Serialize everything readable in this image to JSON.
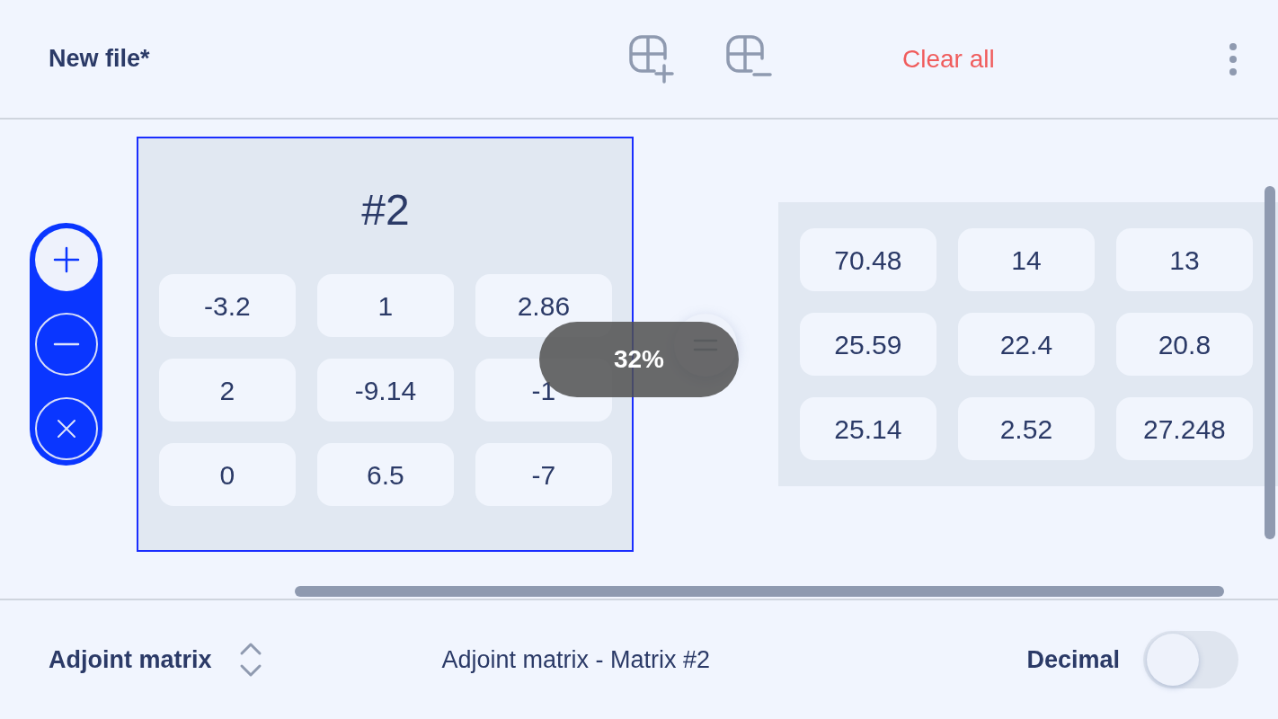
{
  "header": {
    "title": "New file*",
    "clear_label": "Clear all"
  },
  "operations": [
    {
      "kind": "add",
      "selected": true
    },
    {
      "kind": "subtract",
      "selected": false
    },
    {
      "kind": "multiply",
      "selected": false
    }
  ],
  "matrix": {
    "title": "#2",
    "selected": true,
    "rows": [
      [
        "-3.2",
        "1",
        "2.86"
      ],
      [
        "2",
        "-9.14",
        "-1"
      ],
      [
        "0",
        "6.5",
        "-7"
      ]
    ]
  },
  "result": {
    "rows": [
      [
        "70.48",
        "14",
        "13"
      ],
      [
        "25.59",
        "22.4",
        "20.8"
      ],
      [
        "25.14",
        "2.52",
        "27.248"
      ]
    ]
  },
  "toast": "32%",
  "footer": {
    "mode": "Adjoint matrix",
    "description": "Adjoint matrix - Matrix #2",
    "decimal": {
      "label": "Decimal",
      "on": false
    }
  }
}
